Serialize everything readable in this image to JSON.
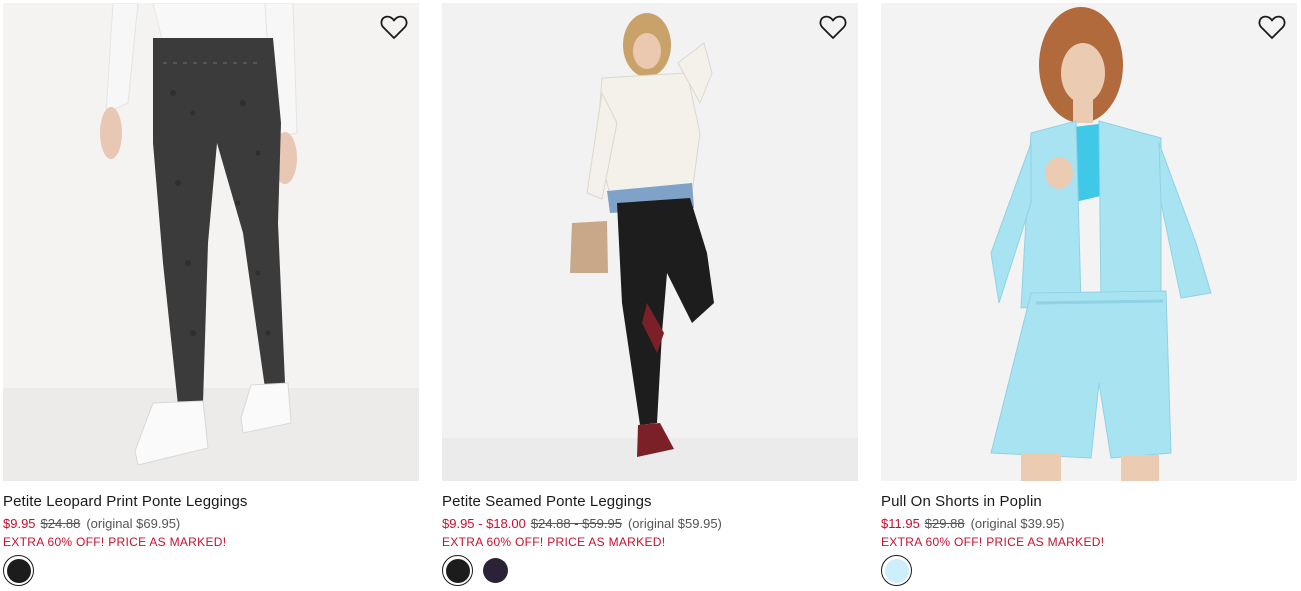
{
  "products": [
    {
      "title": "Petite Leopard Print Ponte Leggings",
      "sale_price": "$9.95",
      "was_price": "$24.88",
      "original_price": "(original $69.95)",
      "promo": "EXTRA 60% OFF! PRICE AS MARKED!",
      "favorite_icon": "heart-outline-icon",
      "swatches": [
        {
          "color": "#1c1c1c",
          "selected": true
        }
      ]
    },
    {
      "title": "Petite Seamed Ponte Leggings",
      "sale_price": "$9.95 - $18.00",
      "was_price": "$24.88 - $59.95",
      "original_price": "(original $59.95)",
      "promo": "EXTRA 60% OFF! PRICE AS MARKED!",
      "favorite_icon": "heart-outline-icon",
      "swatches": [
        {
          "color": "#1c1c1c",
          "selected": true
        },
        {
          "color": "#2b2238",
          "selected": false
        }
      ]
    },
    {
      "title": "Pull On Shorts in Poplin",
      "sale_price": "$11.95",
      "was_price": "$29.88",
      "original_price": "(original $39.95)",
      "promo": "EXTRA 60% OFF! PRICE AS MARKED!",
      "favorite_icon": "heart-outline-icon",
      "swatches": [
        {
          "color": "#cdeefa",
          "selected": true
        }
      ]
    }
  ],
  "colors": {
    "sale_red": "#c8102e",
    "text": "#1a1a1a",
    "muted": "#555555"
  }
}
